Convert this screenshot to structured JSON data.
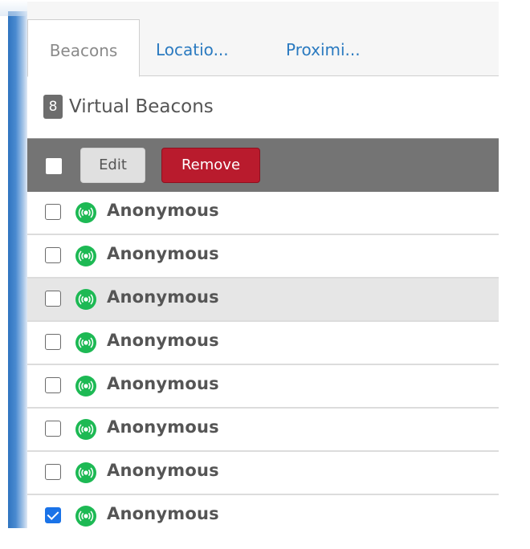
{
  "tabs": [
    {
      "label": "Beacons",
      "active": true
    },
    {
      "label": "Locatio...",
      "active": false
    },
    {
      "label": "Proximi...",
      "active": false
    }
  ],
  "heading": {
    "count": "8",
    "title": "Virtual Beacons"
  },
  "toolbar": {
    "edit_label": "Edit",
    "remove_label": "Remove",
    "select_all_checked": false
  },
  "beacons": [
    {
      "name": "Anonymous",
      "checked": false,
      "highlighted": false,
      "icon": "beacon-signal-icon"
    },
    {
      "name": "Anonymous",
      "checked": false,
      "highlighted": false,
      "icon": "beacon-signal-icon"
    },
    {
      "name": "Anonymous",
      "checked": false,
      "highlighted": true,
      "icon": "beacon-signal-icon"
    },
    {
      "name": "Anonymous",
      "checked": false,
      "highlighted": false,
      "icon": "beacon-signal-icon"
    },
    {
      "name": "Anonymous",
      "checked": false,
      "highlighted": false,
      "icon": "beacon-signal-icon"
    },
    {
      "name": "Anonymous",
      "checked": false,
      "highlighted": false,
      "icon": "beacon-signal-icon"
    },
    {
      "name": "Anonymous",
      "checked": false,
      "highlighted": false,
      "icon": "beacon-signal-icon"
    },
    {
      "name": "Anonymous",
      "checked": true,
      "highlighted": false,
      "icon": "beacon-signal-icon"
    }
  ],
  "colors": {
    "accent": "#2a7ac0",
    "danger": "#b91b2d",
    "beacon": "#1db954",
    "checkbox_checked": "#1a73e8",
    "toolbar": "#747474"
  }
}
